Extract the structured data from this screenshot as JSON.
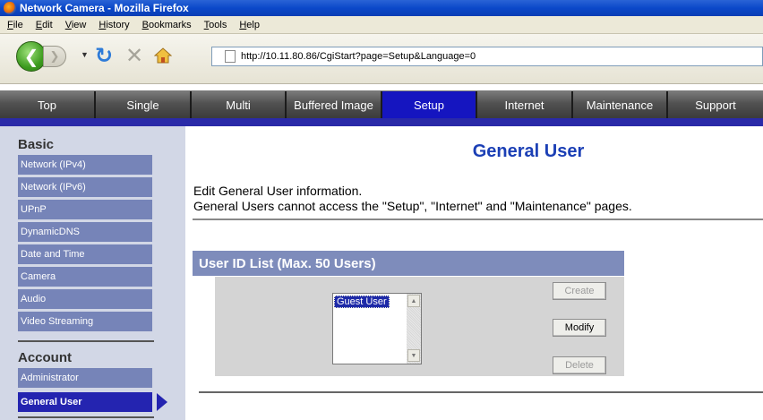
{
  "window": {
    "title": "Network Camera - Mozilla Firefox"
  },
  "menu": [
    "File",
    "Edit",
    "View",
    "History",
    "Bookmarks",
    "Tools",
    "Help"
  ],
  "toolbar": {
    "url": "http://10.11.80.86/CgiStart?page=Setup&Language=0"
  },
  "tabs": [
    {
      "label": "Top",
      "active": false
    },
    {
      "label": "Single",
      "active": false
    },
    {
      "label": "Multi",
      "active": false
    },
    {
      "label": "Buffered Image",
      "active": false
    },
    {
      "label": "Setup",
      "active": true
    },
    {
      "label": "Internet",
      "active": false
    },
    {
      "label": "Maintenance",
      "active": false
    },
    {
      "label": "Support",
      "active": false
    }
  ],
  "sidebar": {
    "basic_heading": "Basic",
    "basic_items": [
      "Network (IPv4)",
      "Network (IPv6)",
      "UPnP",
      "DynamicDNS",
      "Date and Time",
      "Camera",
      "Audio",
      "Video Streaming"
    ],
    "account_heading": "Account",
    "account_items": [
      "Administrator",
      "General User"
    ],
    "active_item": "General User"
  },
  "main": {
    "title": "General User",
    "description_line1": "Edit General User information.",
    "description_line2": "General Users cannot access the \"Setup\", \"Internet\" and \"Maintenance\" pages.",
    "list_header": "User ID List (Max. 50 Users)",
    "list_options": [
      "Guest User"
    ],
    "buttons": {
      "create": "Create",
      "modify": "Modify",
      "delete": "Delete"
    }
  },
  "colors": {
    "accent": "#1515c0",
    "sidebar_item": "#7684b8",
    "title": "#1b3fb5"
  }
}
